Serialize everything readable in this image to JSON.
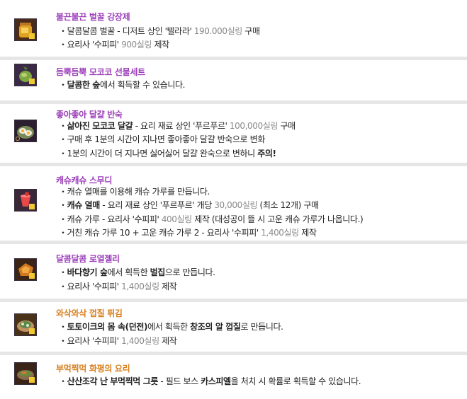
{
  "items": [
    {
      "title": "불끈불끈 벌꿀 강장제",
      "title_color": "purple",
      "icon": "honey-jar-icon",
      "lines": [
        [
          {
            "t": "・달콤달콤 벌꿀 - 디저트 상인 '텔라라' "
          },
          {
            "t": "190.000실링",
            "s": "g"
          },
          {
            "t": " 구매"
          }
        ],
        [
          {
            "t": "・요리사 '수피피' "
          },
          {
            "t": "900실링",
            "s": "g"
          },
          {
            "t": " 제작"
          }
        ]
      ]
    },
    {
      "title": "듬뿍듬뿍 모코코 선물세트",
      "title_color": "purple",
      "icon": "mokoko-fruit-icon",
      "lines": [
        [
          {
            "t": "・"
          },
          {
            "t": "달콤한 숲",
            "s": "b"
          },
          {
            "t": "에서 획득할 수 있습니다."
          }
        ]
      ]
    },
    {
      "title": "좋아좋아 달걀 반숙",
      "title_color": "purple",
      "icon": "egg-plate-icon",
      "lines": [
        [
          {
            "t": "・"
          },
          {
            "t": "삶아진 모코코 달걀",
            "s": "b"
          },
          {
            "t": " - 요리 재료 상인 '푸르푸르' "
          },
          {
            "t": "100,000실링",
            "s": "g"
          },
          {
            "t": " 구매"
          }
        ],
        [
          {
            "t": "・구매 후 1분의 시간이 지나면 좋아좋아 달걀 반숙으로 변화"
          }
        ],
        [
          {
            "t": "・1분의 시간이 더 지나면 싫어싫어 달걀 완숙으로 변하니 "
          },
          {
            "t": "주의!",
            "s": "b"
          }
        ]
      ]
    },
    {
      "title": "캐슈캐슈 스무디",
      "title_color": "purple",
      "icon": "smoothie-icon",
      "lines": [
        [
          {
            "t": "・캐슈 열매를 이용해 캐슈 가루를 만듭니다."
          }
        ],
        [
          {
            "t": "・"
          },
          {
            "t": "캐슈 열매",
            "s": "b"
          },
          {
            "t": " - 요리 재료 상인 '푸르푸르' 개당 "
          },
          {
            "t": "30,000실링",
            "s": "g"
          },
          {
            "t": " (최소 12개) 구매"
          }
        ],
        [
          {
            "t": "・캐슈 가루 - 요리사 '수피피' "
          },
          {
            "t": "400실링",
            "s": "g"
          },
          {
            "t": " 제작 (대성공이 뜰 시 고운 캐슈 가루가 나옵니다.)"
          }
        ],
        [
          {
            "t": "・거친 캐슈 가루 10 + 고운 캐슈 가루 2 - 요리사 '수피피' "
          },
          {
            "t": "1,400실링",
            "s": "g"
          },
          {
            "t": " 제작"
          }
        ]
      ]
    },
    {
      "title": "달콤달콤 로열젤리",
      "title_color": "purple",
      "icon": "royal-jelly-icon",
      "lines": [
        [
          {
            "t": "・"
          },
          {
            "t": "바다향기 숲",
            "s": "b"
          },
          {
            "t": "에서 획득한 "
          },
          {
            "t": "벌집",
            "s": "b"
          },
          {
            "t": "으로 만듭니다."
          }
        ],
        [
          {
            "t": "・요리사 '수피피' "
          },
          {
            "t": "1,400실링",
            "s": "g"
          },
          {
            "t": " 제작"
          }
        ]
      ]
    },
    {
      "title": "와삭와삭 껍질 튀김",
      "title_color": "orange",
      "icon": "fried-shell-icon",
      "lines": [
        [
          {
            "t": "・"
          },
          {
            "t": "토토이크의 몸 속(던전)",
            "s": "b"
          },
          {
            "t": "에서 획득한 "
          },
          {
            "t": "창조의 알 껍질",
            "s": "b"
          },
          {
            "t": "로 만듭니다."
          }
        ],
        [
          {
            "t": "・요리사 '수피피' "
          },
          {
            "t": "1,400실링",
            "s": "g"
          },
          {
            "t": " 제작"
          }
        ]
      ]
    },
    {
      "title": "부먹찍먹 화평의 요리",
      "title_color": "orange",
      "icon": "peace-dish-icon",
      "lines": [
        [
          {
            "t": "・"
          },
          {
            "t": "산산조각 난 부먹찍먹 그릇",
            "s": "b"
          },
          {
            "t": " - 필드 보스 "
          },
          {
            "t": "카스피엘",
            "s": "b"
          },
          {
            "t": "을 처치 시 확률로 획득할 수 있습니다."
          }
        ]
      ]
    }
  ],
  "colors": {
    "purple": "#9b3db8",
    "orange": "#d8801f",
    "grey": "#8a8a8a",
    "separator": "#e6e6e6"
  }
}
